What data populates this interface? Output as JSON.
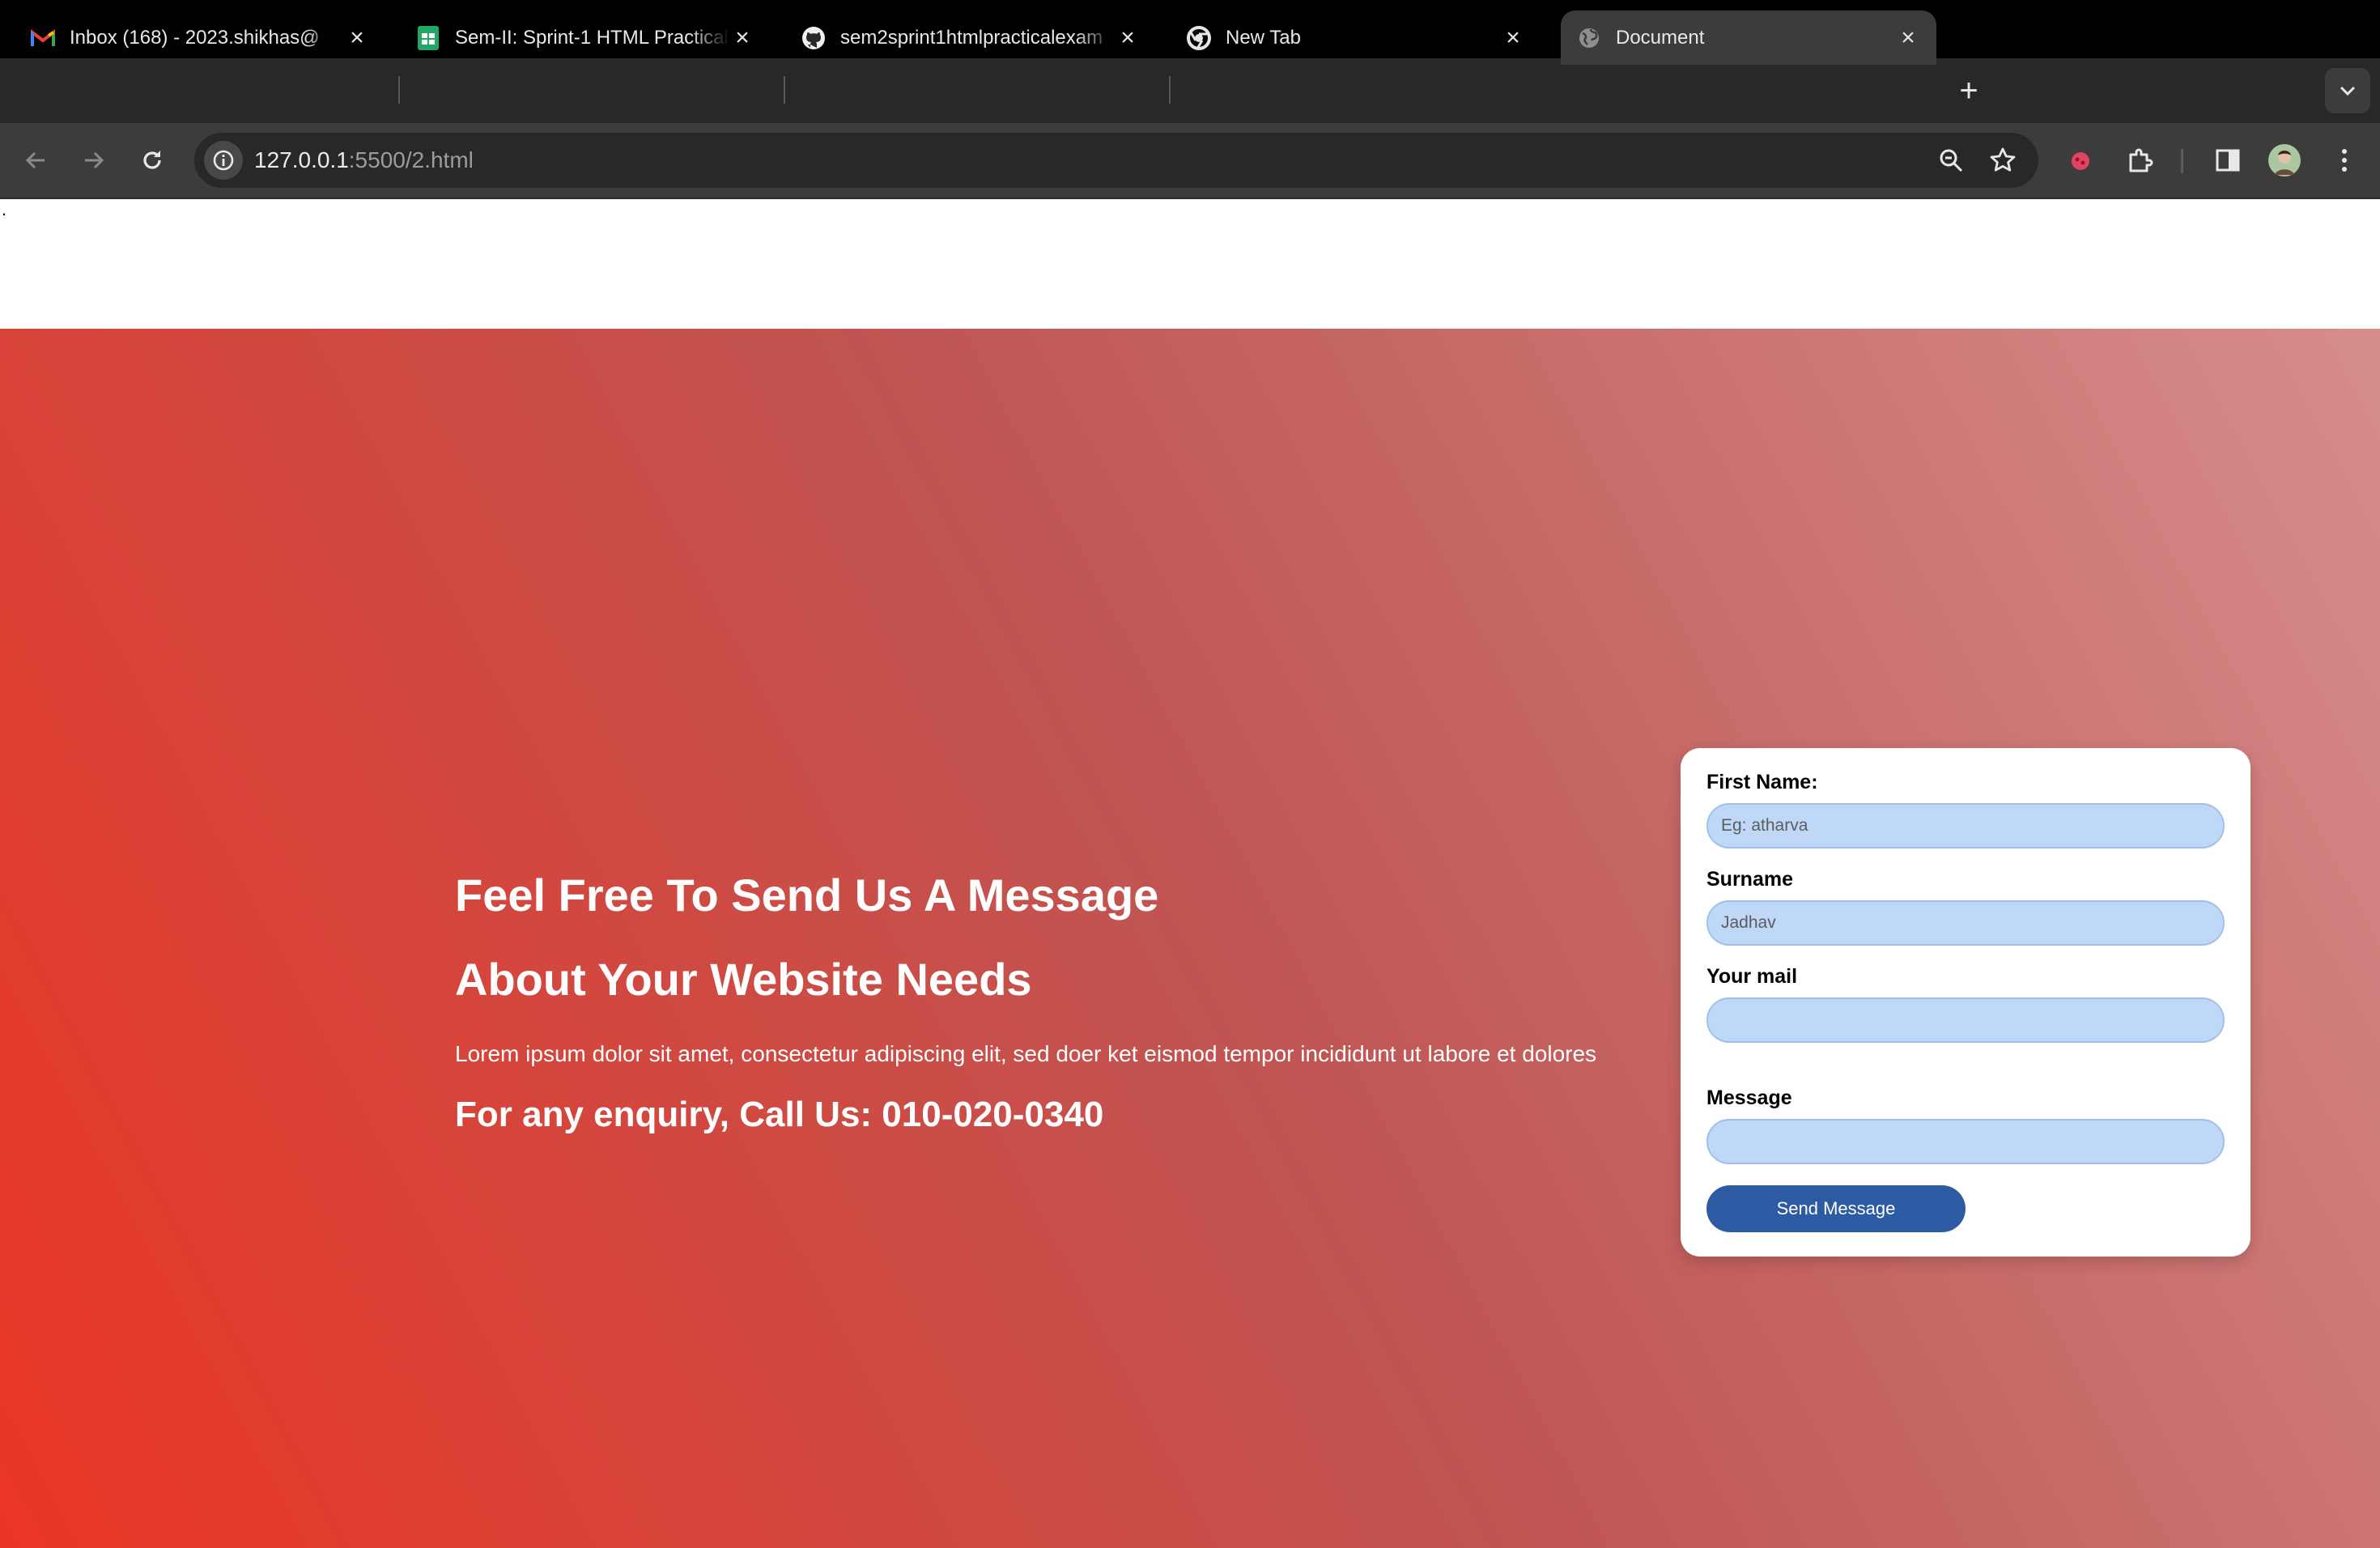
{
  "browser": {
    "tabs": [
      {
        "title": "Inbox (168) - 2023.shikhas@",
        "icon": "gmail-icon",
        "active": false
      },
      {
        "title": "Sem-II: Sprint-1 HTML Practical",
        "icon": "sheets-icon",
        "active": false
      },
      {
        "title": "sem2sprint1htmlpracticalexam",
        "icon": "github-icon",
        "active": false
      },
      {
        "title": "New Tab",
        "icon": "chrome-icon",
        "active": false
      },
      {
        "title": "Document",
        "icon": "globe-icon",
        "active": true
      }
    ],
    "url_host": "127.0.0.1",
    "url_path": ":5500/2.html",
    "colors": {
      "tabstrip": "#282828",
      "toolbar": "#3c3c3c",
      "omnibox": "#282828"
    }
  },
  "page": {
    "dot": ".",
    "heading_line1": "Feel Free To Send Us A Message",
    "heading_line2": "About Your Website Needs",
    "lorem": "Lorem ipsum dolor sit amet, consectetur adipiscing elit, sed doer ket eismod tempor incididunt ut labore et dolores",
    "enquiry": "For any enquiry, Call Us: 010-020-0340",
    "gradient_colors": [
      "#ea3524",
      "#bf5654",
      "#d68d8b"
    ]
  },
  "form": {
    "first_name_label": "First Name:",
    "first_name_placeholder": "Eg: atharva",
    "surname_label": "Surname",
    "surname_placeholder": "Jadhav",
    "mail_label": "Your mail",
    "mail_placeholder": "",
    "message_label": "Message",
    "message_placeholder": "",
    "send_label": "Send Message",
    "colors": {
      "input_bg": "#c0d8f8",
      "button_bg": "#2c5ba3"
    }
  }
}
